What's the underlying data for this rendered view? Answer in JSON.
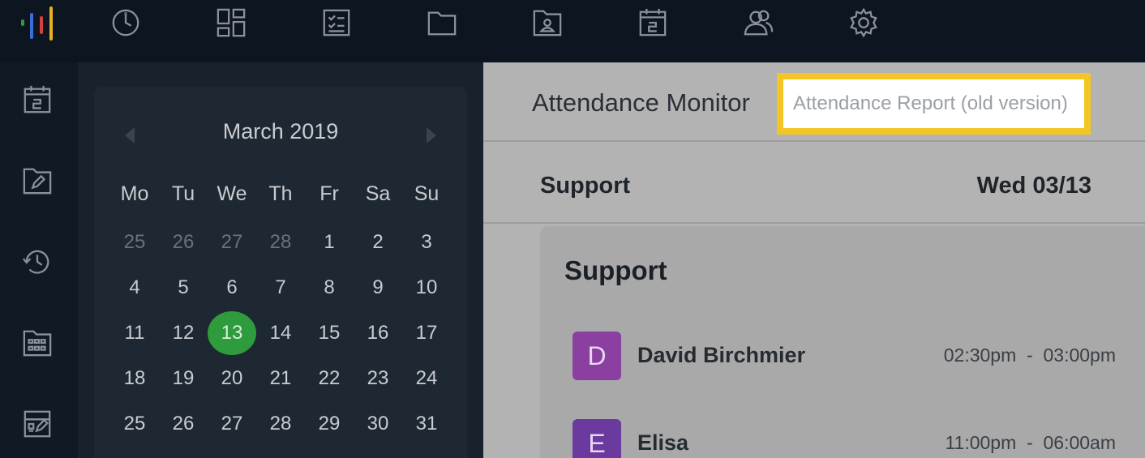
{
  "topnav": {
    "logo_colors": [
      "#2e9b3c",
      "#3b6fd8",
      "#d9403a",
      "#e6b21e"
    ],
    "icons": [
      "clock-icon",
      "dashboard-icon",
      "checklist-icon",
      "folder-icon",
      "profile-folder-icon",
      "calendar-icon",
      "people-icon",
      "settings-icon"
    ]
  },
  "rail": {
    "icons": [
      "calendar-icon",
      "edit-folder-icon",
      "history-icon",
      "calendar-grid-icon",
      "grid-edit-icon"
    ]
  },
  "calendar": {
    "month_label": "March 2019",
    "weekdays": [
      "Mo",
      "Tu",
      "We",
      "Th",
      "Fr",
      "Sa",
      "Su"
    ],
    "days": [
      "25",
      "26",
      "27",
      "28",
      "1",
      "2",
      "3",
      "4",
      "5",
      "6",
      "7",
      "8",
      "9",
      "10",
      "11",
      "12",
      "13",
      "14",
      "15",
      "16",
      "17",
      "18",
      "19",
      "20",
      "21",
      "22",
      "23",
      "24",
      "25",
      "26",
      "27",
      "28",
      "29",
      "30",
      "31"
    ],
    "selected_day": "13",
    "selected_color": "#2e9b3c"
  },
  "main": {
    "title": "Attendance Monitor",
    "report_button": "Attendance Report (old version)",
    "highlight_color": "#f3c623",
    "team": "Support",
    "date": "Wed 03/13",
    "card": {
      "title": "Support",
      "entries": [
        {
          "initial": "D",
          "name": "David Birchmier",
          "start": "02:30pm",
          "sep": "-",
          "end": "03:00pm",
          "avatar_color": "#8b3fa0"
        },
        {
          "initial": "E",
          "name": "Elisa",
          "start": "11:00pm",
          "sep": "-",
          "end": "06:00am",
          "avatar_color": "#6a3a9e"
        }
      ]
    }
  }
}
